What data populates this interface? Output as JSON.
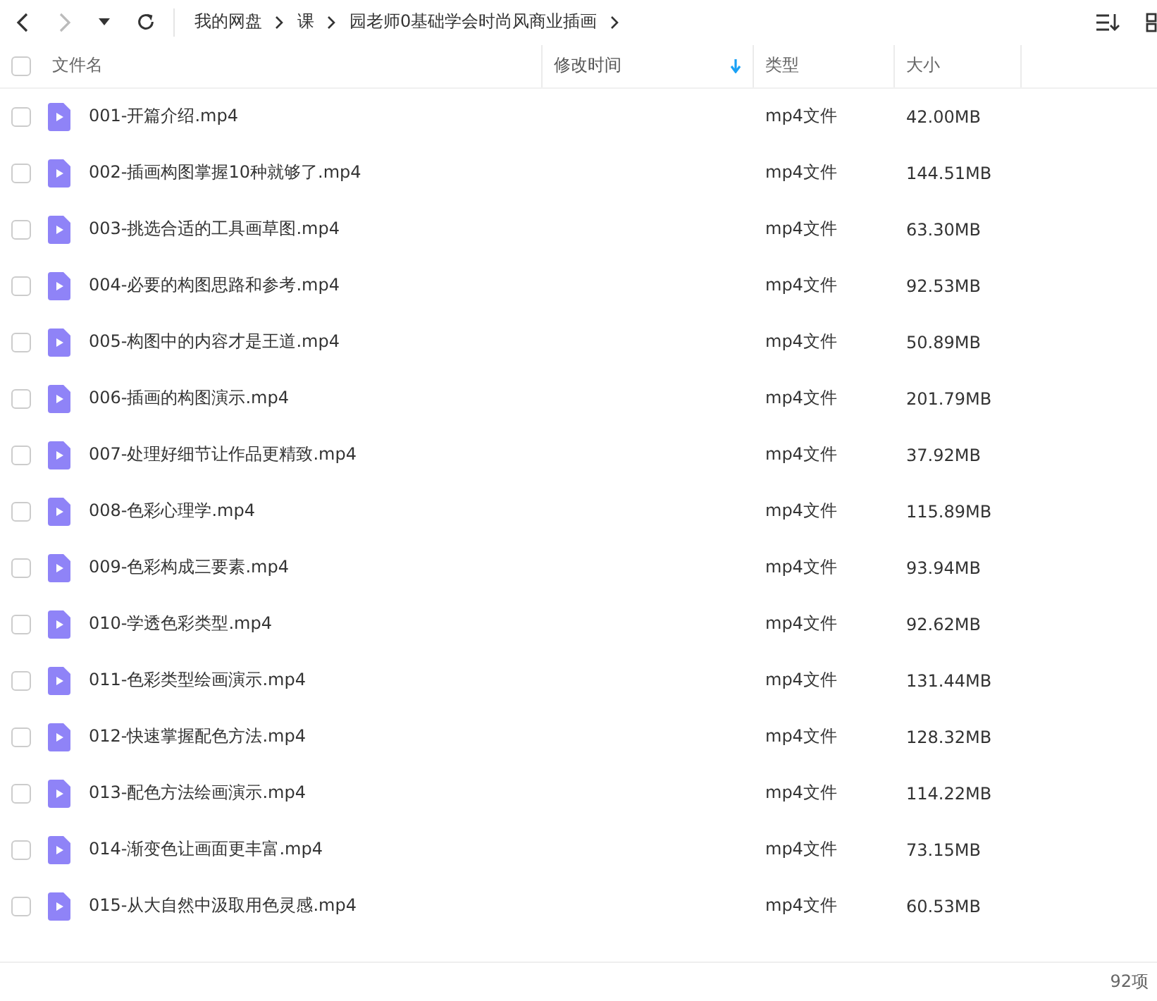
{
  "breadcrumb": [
    "我的网盘",
    "课",
    "园老师0基础学会时尚风商业插画"
  ],
  "columns": [
    {
      "label": "文件名",
      "sorted": false
    },
    {
      "label": "修改时间",
      "sorted": true
    },
    {
      "label": "类型",
      "sorted": false
    },
    {
      "label": "大小",
      "sorted": false
    }
  ],
  "rows": [
    {
      "name": "001-开篇介绍.mp4",
      "type": "mp4文件",
      "size": "42.00MB",
      "checked": false
    },
    {
      "name": "002-插画构图掌握10种就够了.mp4",
      "type": "mp4文件",
      "size": "144.51MB",
      "checked": false
    },
    {
      "name": "003-挑选合适的工具画草图.mp4",
      "type": "mp4文件",
      "size": "63.30MB",
      "checked": false
    },
    {
      "name": "004-必要的构图思路和参考.mp4",
      "type": "mp4文件",
      "size": "92.53MB",
      "checked": false
    },
    {
      "name": "005-构图中的内容才是王道.mp4",
      "type": "mp4文件",
      "size": "50.89MB",
      "checked": false
    },
    {
      "name": "006-插画的构图演示.mp4",
      "type": "mp4文件",
      "size": "201.79MB",
      "checked": false
    },
    {
      "name": "007-处理好细节让作品更精致.mp4",
      "type": "mp4文件",
      "size": "37.92MB",
      "checked": false
    },
    {
      "name": "008-色彩心理学.mp4",
      "type": "mp4文件",
      "size": "115.89MB",
      "checked": false
    },
    {
      "name": "009-色彩构成三要素.mp4",
      "type": "mp4文件",
      "size": "93.94MB",
      "checked": false
    },
    {
      "name": "010-学透色彩类型.mp4",
      "type": "mp4文件",
      "size": "92.62MB",
      "checked": false
    },
    {
      "name": "011-色彩类型绘画演示.mp4",
      "type": "mp4文件",
      "size": "131.44MB",
      "checked": false
    },
    {
      "name": "012-快速掌握配色方法.mp4",
      "type": "mp4文件",
      "size": "128.32MB",
      "checked": false
    },
    {
      "name": "013-配色方法绘画演示.mp4",
      "type": "mp4文件",
      "size": "114.22MB",
      "checked": false
    },
    {
      "name": "014-渐变色让画面更丰富.mp4",
      "type": "mp4文件",
      "size": "73.15MB",
      "checked": false
    },
    {
      "name": "015-从大自然中汲取用色灵感.mp4",
      "type": "mp4文件",
      "size": "60.53MB",
      "checked": false
    }
  ],
  "select_all": {
    "checked": false
  },
  "status_bar": {
    "count": "92项"
  }
}
